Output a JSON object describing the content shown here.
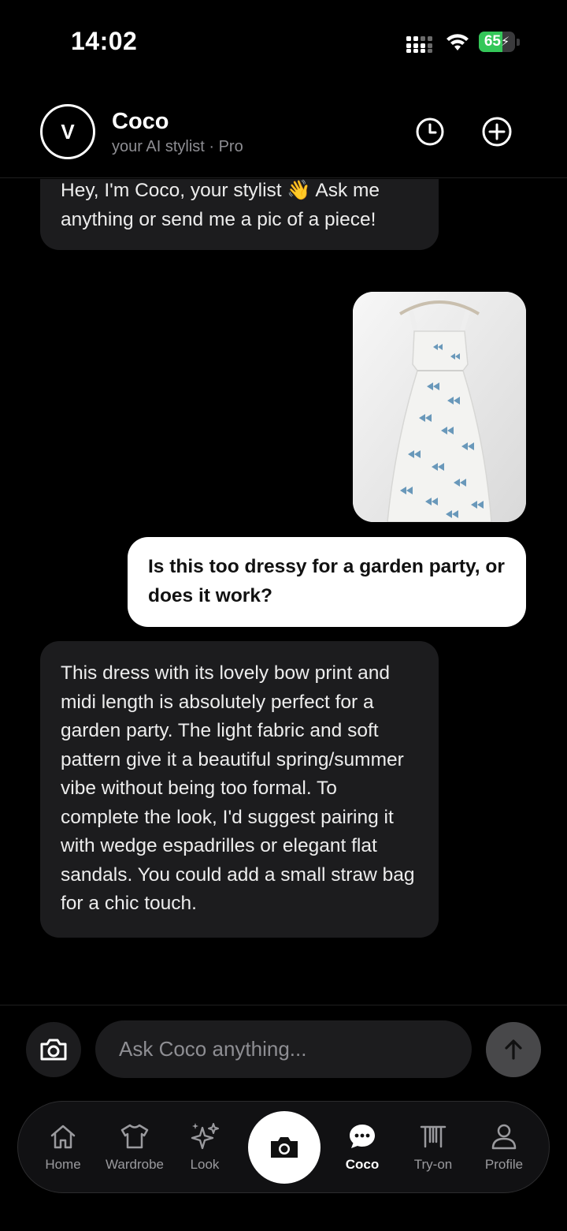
{
  "status_bar": {
    "time": "14:02",
    "battery_level": 65,
    "battery_text": "65",
    "charging": true,
    "battery_color": "#34c759"
  },
  "header": {
    "avatar_letter": "V",
    "title": "Coco",
    "subtitle": "your AI stylist · Pro",
    "history_icon": "clock-icon",
    "new_chat_icon": "plus-circle-icon"
  },
  "chat": {
    "messages": [
      {
        "role": "bot",
        "text": "Hey, I'm Coco, your stylist 👋 Ask me anything or send me a pic of a piece!"
      },
      {
        "role": "user",
        "type": "image",
        "image": "white-dress-with-blue-bow-print-photo"
      },
      {
        "role": "user",
        "text": "Is this too dressy for a garden party, or does it work?"
      },
      {
        "role": "bot",
        "text": "This dress with its lovely bow print and midi length is absolutely perfect for a garden party. The light fabric and soft pattern give it a beautiful spring/summer vibe without being too formal. To complete the look, I'd suggest pairing it with wedge espadrilles or elegant flat sandals. You could add a small straw bag for a chic touch."
      }
    ]
  },
  "composer": {
    "placeholder": "Ask Coco anything...",
    "value": "",
    "camera_icon": "camera-icon",
    "send_icon": "arrow-up-icon"
  },
  "tab_bar": {
    "tabs": [
      {
        "label": "Home",
        "icon": "home-icon",
        "active": false
      },
      {
        "label": "Wardrobe",
        "icon": "tshirt-icon",
        "active": false
      },
      {
        "label": "Look",
        "icon": "sparkles-icon",
        "active": false
      },
      {
        "label": "Coco",
        "icon": "chat-bubble-icon",
        "active": true
      },
      {
        "label": "Try-on",
        "icon": "hanger-rack-icon",
        "active": false
      },
      {
        "label": "Profile",
        "icon": "person-icon",
        "active": false
      }
    ],
    "center_icon": "camera-icon"
  },
  "colors": {
    "background": "#000000",
    "bot_bubble": "#1c1c1e",
    "user_bubble": "#ffffff",
    "muted_text": "#8e8e93"
  }
}
